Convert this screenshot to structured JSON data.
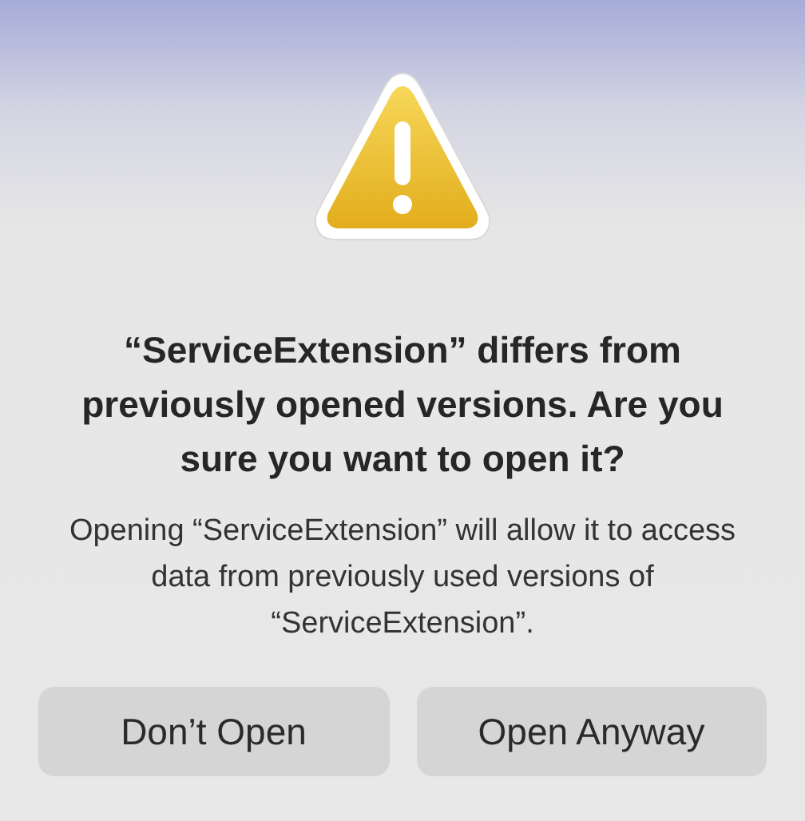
{
  "dialog": {
    "title": "“ServiceExtension” differs from previously opened versions. Are you sure you want to open it?",
    "message": "Opening “ServiceExtension” will allow it to access data from previously used versions of “ServiceExtension”.",
    "buttons": [
      {
        "label": "Don’t Open"
      },
      {
        "label": "Open Anyway"
      }
    ]
  }
}
